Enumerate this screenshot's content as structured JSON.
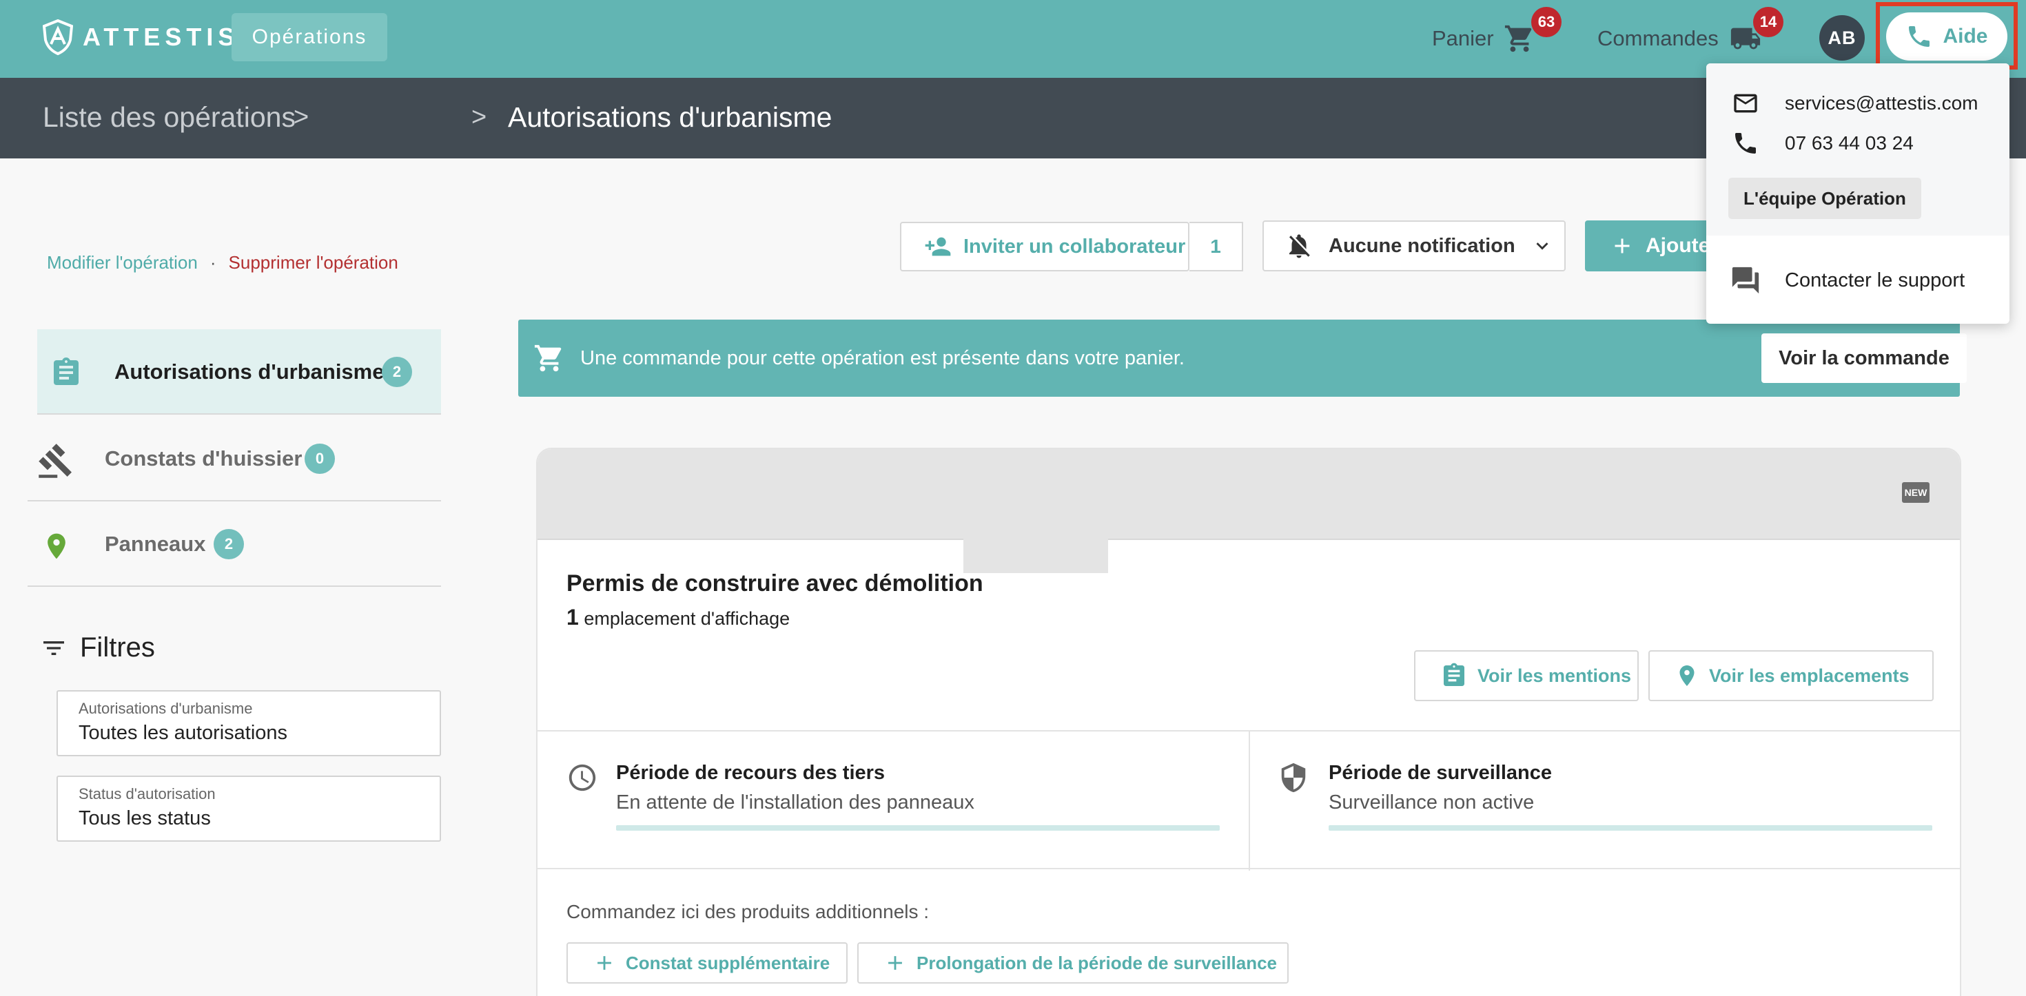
{
  "topbar": {
    "brand": "ATTESTIS",
    "operations_label": "Opérations",
    "cart_label": "Panier",
    "cart_count": "63",
    "orders_label": "Commandes",
    "orders_count": "14",
    "avatar_initials": "AB",
    "help_label": "Aide"
  },
  "breadcrumb": {
    "root": "Liste des opérations",
    "separator": ">",
    "current": "Autorisations d'urbanisme"
  },
  "operation_links": {
    "edit": "Modifier l'opération",
    "separator": "·",
    "delete": "Supprimer l'opération"
  },
  "sidebar": {
    "items": [
      {
        "label": "Autorisations d'urbanisme",
        "count": "2",
        "icon": "clipboard-icon"
      },
      {
        "label": "Constats d'huissier",
        "count": "0",
        "icon": "gavel-icon"
      },
      {
        "label": "Panneaux",
        "count": "2",
        "icon": "map-pin-icon"
      }
    ],
    "filters_title": "Filtres",
    "filters": [
      {
        "label": "Autorisations d'urbanisme",
        "value": "Toutes les autorisations"
      },
      {
        "label": "Status d'autorisation",
        "value": "Tous les status"
      }
    ]
  },
  "toolbar": {
    "invite_label": "Inviter un collaborateur",
    "invite_count": "1",
    "notification_label": "Aucune notification",
    "add_label": "Ajouter"
  },
  "banner": {
    "message": "Une commande pour cette opération est présente dans votre panier.",
    "button_label": "Voir la commande"
  },
  "card": {
    "new_badge": "NEW",
    "title": "Permis de construire avec démolition",
    "locations_count": "1",
    "locations_label": "emplacement d'affichage",
    "view_mentions": "Voir les mentions",
    "view_locations": "Voir les emplacements",
    "periods": [
      {
        "title": "Période de recours des tiers",
        "status": "En attente de l'installation des panneaux",
        "icon": "clock-icon"
      },
      {
        "title": "Période de surveillance",
        "status": "Surveillance non active",
        "icon": "shield-icon"
      }
    ],
    "extras_label": "Commandez ici des produits additionnels :",
    "extras": [
      "Constat supplémentaire",
      "Prolongation de la période de surveillance"
    ]
  },
  "help_menu": {
    "email": "services@attestis.com",
    "phone": "07 63 44 03 24",
    "team_label": "L'équipe Opération",
    "support_label": "Contacter le support"
  },
  "colors": {
    "brand_teal": "#62b5b3",
    "dark_bar": "#424b53",
    "badge_red": "#c0272d",
    "delete_red": "#b33031",
    "highlight": "#e03b24"
  }
}
